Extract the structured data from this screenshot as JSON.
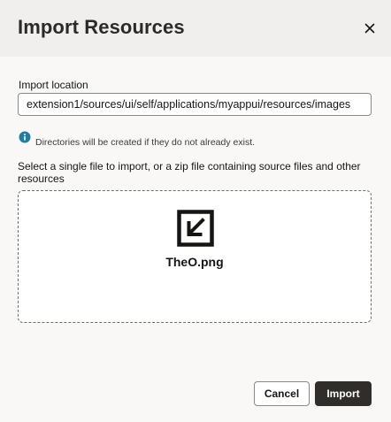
{
  "dialog": {
    "title": "Import Resources",
    "close_icon": "close-icon"
  },
  "location": {
    "label": "Import location",
    "value": "extension1/sources/ui/self/applications/myappui/resources/images"
  },
  "info": {
    "icon": "info-icon",
    "text": "Directories will be created if they do not already exist."
  },
  "upload": {
    "instructions": "Select a single file to import, or a zip file containing source files and other resources",
    "file_icon": "import-file-icon",
    "file_name": "TheO.png"
  },
  "footer": {
    "cancel_label": "Cancel",
    "import_label": "Import"
  },
  "colors": {
    "header_bg": "#f1efed",
    "body_bg": "#faf8f7",
    "primary_button": "#312d2a",
    "info_icon": "#227e9e"
  }
}
